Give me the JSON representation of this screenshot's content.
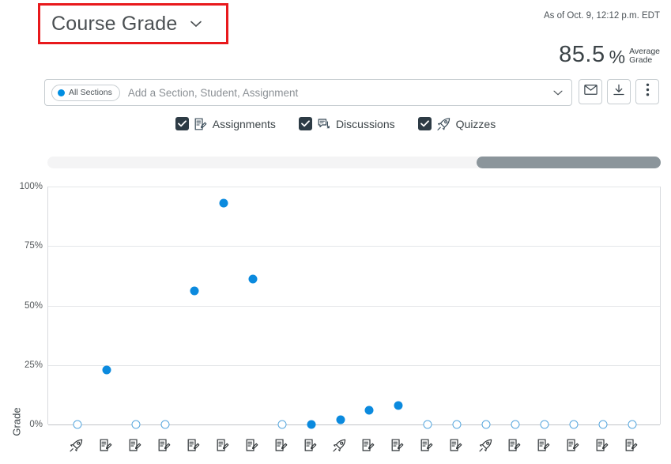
{
  "header": {
    "title": "Course Grade",
    "title_caret_icon": "chevron-down-icon",
    "as_of": "As of Oct. 9, 12:12 p.m. EDT",
    "average_value": "85.5",
    "average_percent_symbol": "%",
    "average_label_line1": "Average",
    "average_label_line2": "Grade",
    "highlight_color": "#e8191c"
  },
  "search": {
    "pill_label": "All Sections",
    "pill_dot_icon": "blue-dot-icon",
    "placeholder": "Add a Section, Student, Assignment",
    "value": "",
    "caret_icon": "chevron-down-icon",
    "buttons": [
      {
        "name": "message-students-button",
        "icon": "envelope-icon"
      },
      {
        "name": "download-button",
        "icon": "download-icon"
      },
      {
        "name": "more-options-button",
        "icon": "kebab-menu-icon"
      }
    ]
  },
  "filters": [
    {
      "label": "Assignments",
      "icon": "assignment-icon",
      "checked": true
    },
    {
      "label": "Discussions",
      "icon": "discussion-icon",
      "checked": true
    },
    {
      "label": "Quizzes",
      "icon": "quiz-rocket-icon",
      "checked": true
    }
  ],
  "scrollbar": {
    "name": "horizontal-scrollbar",
    "thumb_position": "right",
    "track_color": "#f4f4f5",
    "thumb_color": "#8b959b"
  },
  "chart_data": {
    "type": "scatter",
    "title": "",
    "xlabel": "",
    "ylabel": "Grade",
    "ylim": [
      0,
      100
    ],
    "yticks": [
      0,
      25,
      50,
      75,
      100
    ],
    "ytick_labels": [
      "0%",
      "25%",
      "50%",
      "75%",
      "100%"
    ],
    "grid": true,
    "legend": "none",
    "point_color_filled": "#0b8ade",
    "point_color_hollow": "#57a7de",
    "series": [
      {
        "name": "Grade",
        "points": [
          {
            "index": 1,
            "icon": "quiz-rocket-icon",
            "value": 0,
            "state": "ungraded"
          },
          {
            "index": 2,
            "icon": "assignment-icon",
            "value": 23,
            "state": "graded"
          },
          {
            "index": 3,
            "icon": "assignment-icon",
            "value": 0,
            "state": "ungraded"
          },
          {
            "index": 4,
            "icon": "assignment-icon",
            "value": 0,
            "state": "ungraded"
          },
          {
            "index": 5,
            "icon": "assignment-icon",
            "value": 56,
            "state": "graded"
          },
          {
            "index": 6,
            "icon": "assignment-icon",
            "value": 93,
            "state": "graded"
          },
          {
            "index": 7,
            "icon": "assignment-icon",
            "value": 61,
            "state": "graded"
          },
          {
            "index": 8,
            "icon": "assignment-icon",
            "value": 0,
            "state": "ungraded"
          },
          {
            "index": 9,
            "icon": "assignment-icon",
            "value": 0,
            "state": "graded"
          },
          {
            "index": 10,
            "icon": "quiz-rocket-icon",
            "value": 2,
            "state": "graded"
          },
          {
            "index": 11,
            "icon": "assignment-icon",
            "value": 6,
            "state": "graded"
          },
          {
            "index": 12,
            "icon": "assignment-icon",
            "value": 8,
            "state": "graded"
          },
          {
            "index": 13,
            "icon": "assignment-icon",
            "value": 0,
            "state": "ungraded"
          },
          {
            "index": 14,
            "icon": "assignment-icon",
            "value": 0,
            "state": "ungraded"
          },
          {
            "index": 15,
            "icon": "quiz-rocket-icon",
            "value": 0,
            "state": "ungraded"
          },
          {
            "index": 16,
            "icon": "assignment-icon",
            "value": 0,
            "state": "ungraded"
          },
          {
            "index": 17,
            "icon": "assignment-icon",
            "value": 0,
            "state": "ungraded"
          },
          {
            "index": 18,
            "icon": "assignment-icon",
            "value": 0,
            "state": "ungraded"
          },
          {
            "index": 19,
            "icon": "assignment-icon",
            "value": 0,
            "state": "ungraded"
          },
          {
            "index": 20,
            "icon": "assignment-icon",
            "value": 0,
            "state": "ungraded"
          }
        ]
      }
    ]
  }
}
